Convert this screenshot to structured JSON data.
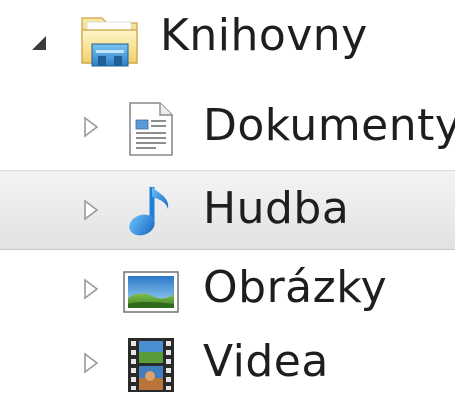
{
  "tree": {
    "root": {
      "label": "Knihovny",
      "expanded": true,
      "icon": "libraries-folder-icon"
    },
    "items": [
      {
        "label": "Dokumenty",
        "icon": "documents-icon",
        "expanded": false,
        "hovered": false
      },
      {
        "label": "Hudba",
        "icon": "music-note-icon",
        "expanded": false,
        "hovered": true
      },
      {
        "label": "Obrázky",
        "icon": "pictures-icon",
        "expanded": false,
        "hovered": false
      },
      {
        "label": "Videa",
        "icon": "film-strip-icon",
        "expanded": false,
        "hovered": false
      }
    ]
  },
  "colors": {
    "hover_background": "#e9e9e9",
    "text": "#1e1e1e",
    "music_blue": "#1f7fd8"
  }
}
